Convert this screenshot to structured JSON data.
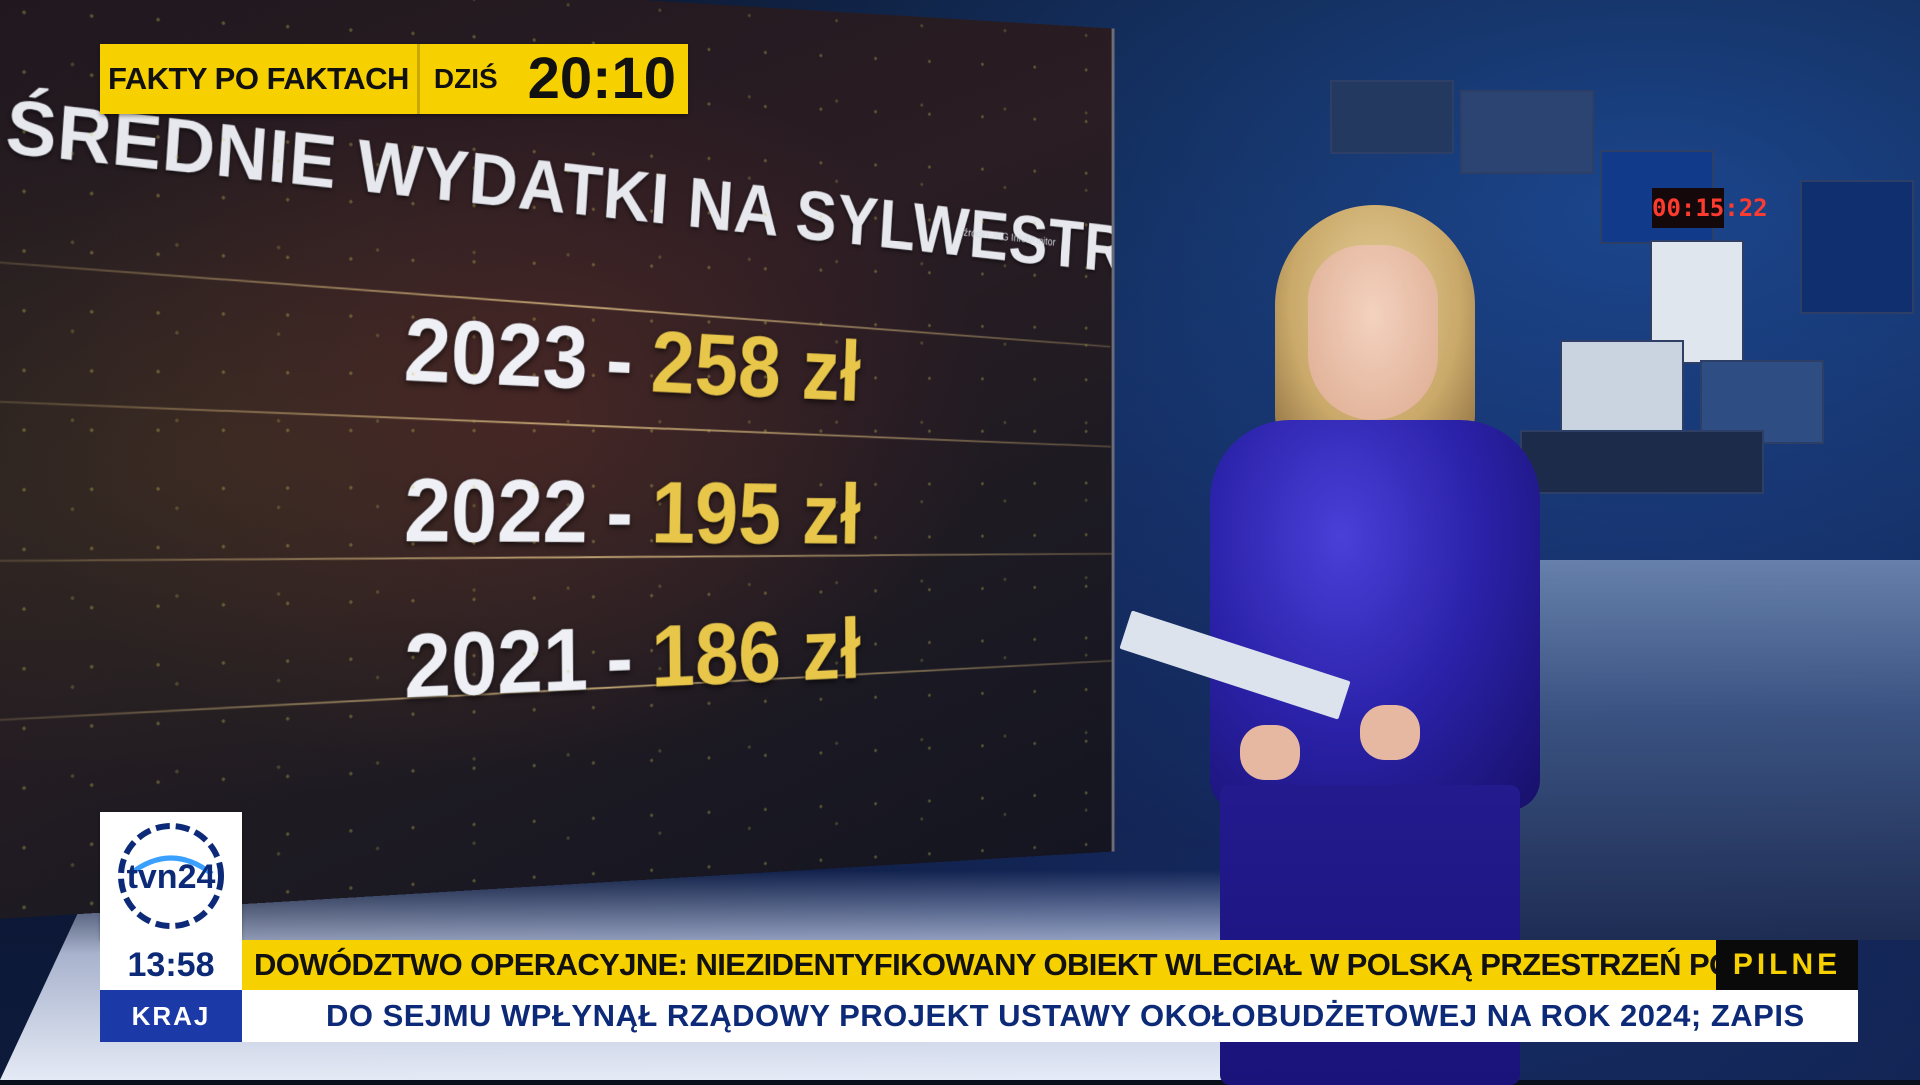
{
  "promo": {
    "show": "FAKTY PO FAKTACH",
    "day": "DZIŚ",
    "time": "20:10"
  },
  "wall_graphic": {
    "title": "ŚREDNIE WYDATKI NA SYLWESTRA",
    "source": "źródło: BIG InfoMonitor",
    "rows": [
      {
        "year": "2023",
        "dash": "-",
        "amount": "258 zł"
      },
      {
        "year": "2022",
        "dash": "-",
        "amount": "195 zł"
      },
      {
        "year": "2021",
        "dash": "-",
        "amount": "186 zł"
      }
    ]
  },
  "studio": {
    "monitor_clock": "00:15:22"
  },
  "logo": {
    "text": "tvn24",
    "icon": "tvn24-logo-icon"
  },
  "lower_third": {
    "clock": "13:58",
    "section": "KRAJ",
    "headline": "DOWÓDZTWO OPERACYJNE: NIEZIDENTYFIKOWANY OBIEKT WLECIAŁ W POLSKĄ PRZESTRZEŃ POWIETRZNĄ OD STRONY UKRAINY",
    "urgency": "PILNE",
    "ticker": "DO SEJMU WPŁYNĄŁ RZĄDOWY PROJEKT USTAWY OKOŁOBUDŻETOWEJ NA ROK 2024; ZAPIS"
  },
  "colors": {
    "yellow": "#f7d000",
    "blue": "#1b3aa8",
    "navy_text": "#0d2a78",
    "amount_gold": "#e8c64a"
  }
}
